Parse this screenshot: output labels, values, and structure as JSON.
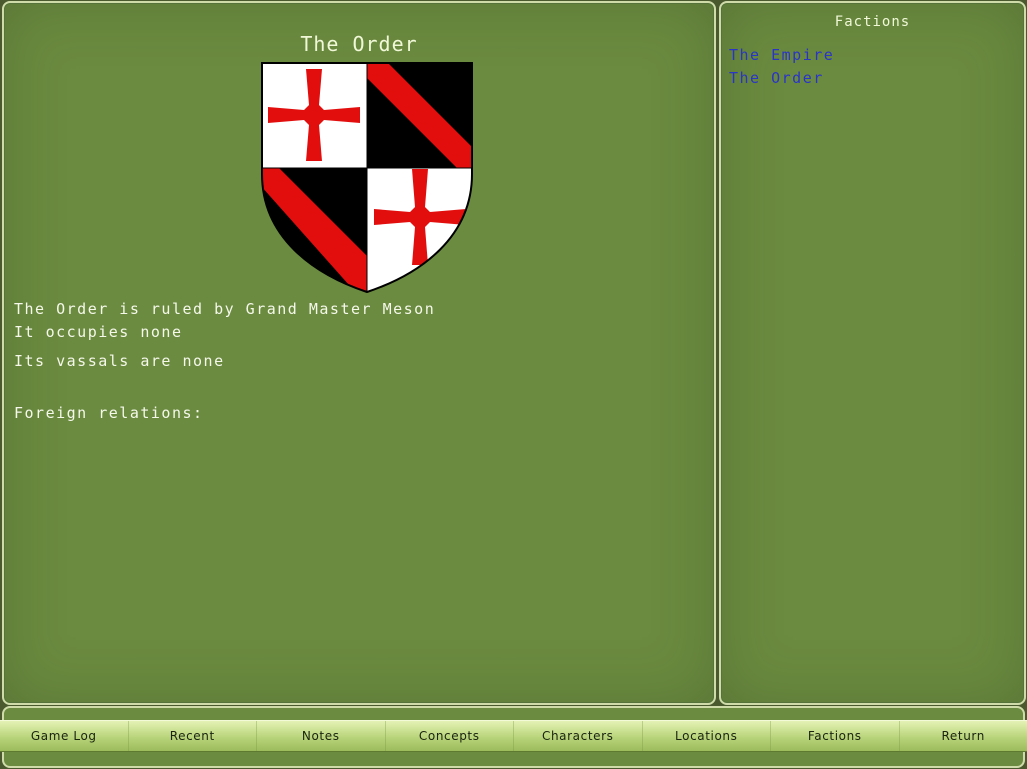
{
  "main": {
    "title": "The Order",
    "ruler_text": "The Order is ruled by Grand Master Meson",
    "occupies_text": "It occupies none",
    "vassals_text": "Its vassals are none",
    "relations_text": "Foreign relations:",
    "shield_icon": "quartered-cross-shield-icon",
    "colors": {
      "cross_red": "#e20e0e",
      "field_black": "#000000",
      "field_white": "#ffffff"
    }
  },
  "sidebar": {
    "title": "Factions",
    "factions": [
      "The Empire",
      "The Order"
    ]
  },
  "nav": {
    "buttons": [
      "Game Log",
      "Recent",
      "Notes",
      "Concepts",
      "Characters",
      "Locations",
      "Factions",
      "Return"
    ]
  },
  "colors": {
    "panel_green": "#6b8b40",
    "panel_border": "#cfdcaa",
    "link_blue": "#2a34c8",
    "text_light": "#f5f8ea"
  }
}
